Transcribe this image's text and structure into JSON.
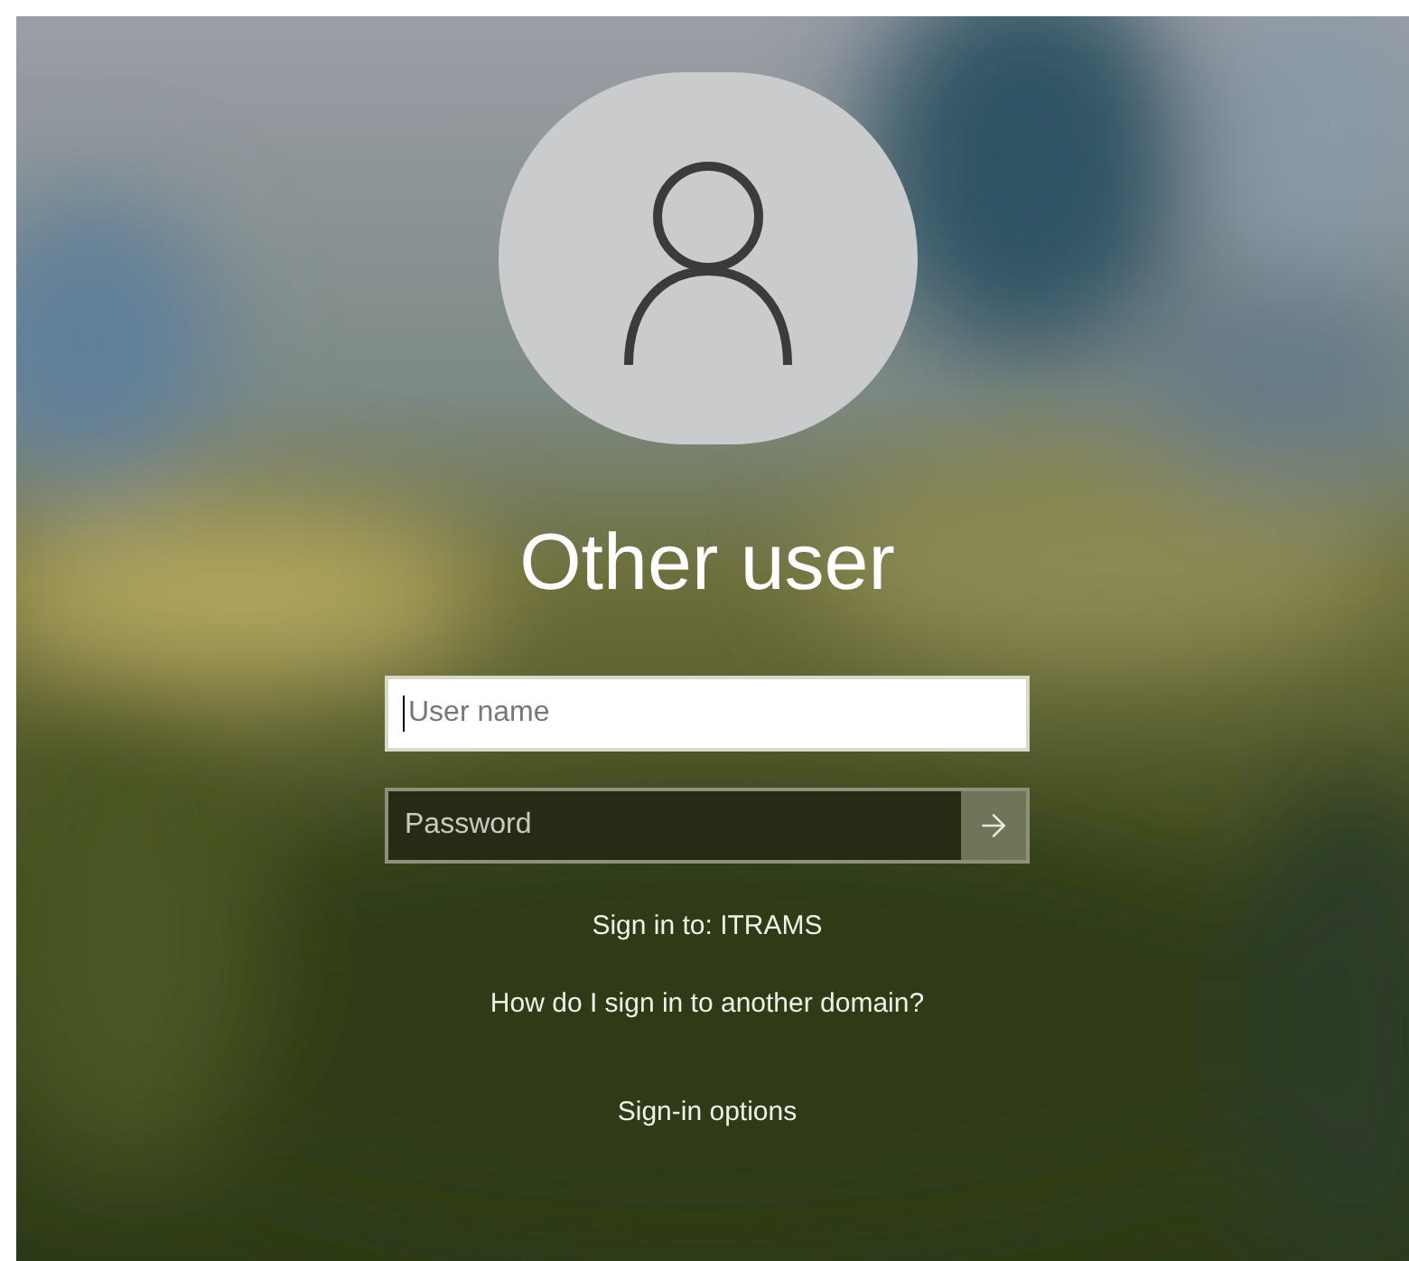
{
  "user": {
    "name": "Other user"
  },
  "username_field": {
    "placeholder": "User name",
    "focused": true
  },
  "password_field": {
    "placeholder": "Password"
  },
  "sign_in_to": "Sign in to: ITRAMS",
  "links": [
    "How do I sign in to another domain?",
    "Sign-in options"
  ]
}
